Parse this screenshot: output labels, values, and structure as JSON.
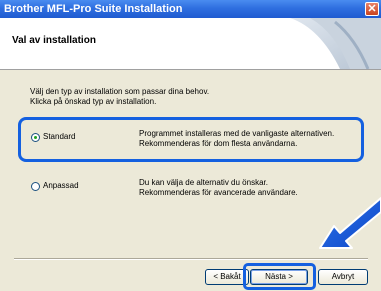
{
  "window": {
    "title": "Brother MFL-Pro Suite Installation",
    "close_symbol": "✕"
  },
  "header": {
    "title": "Val av installation"
  },
  "instructions": {
    "line1": "Välj den typ av installation som passar dina behov.",
    "line2": "Klicka på önskad typ av installation."
  },
  "options": {
    "standard": {
      "label": "Standard",
      "desc1": "Programmet installeras med de vanligaste alternativen.",
      "desc2": "Rekommenderas för dom flesta användarna.",
      "selected": true
    },
    "custom": {
      "label": "Anpassad",
      "desc1": "Du kan välja de alternativ du önskar.",
      "desc2": "Rekommenderas för avancerade användare.",
      "selected": false
    }
  },
  "buttons": {
    "back": "< Bakåt",
    "next": "Nästa >",
    "cancel": "Avbryt"
  },
  "colors": {
    "highlight": "#1460e0",
    "titlebar": "#2f6fe0"
  }
}
